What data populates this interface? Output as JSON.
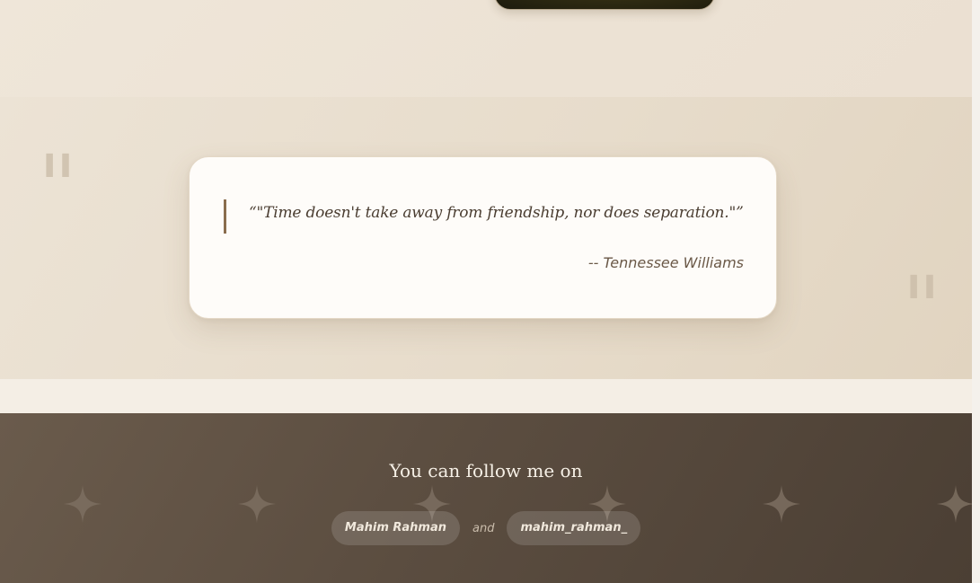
{
  "quote": {
    "text": "“\"Time doesn't take away from friendship, nor does separation.\"”",
    "author": "-- Tennessee Williams",
    "decor_left": "\"",
    "decor_right": "\""
  },
  "footer": {
    "title": "You can follow me on",
    "link_primary": "Mahim Rahman",
    "separator": "and",
    "link_secondary": "mahim_rahman_"
  },
  "icons": {
    "quote_decor": "quote-mark-icon",
    "footer_decor": "sparkle-icon"
  },
  "colors": {
    "card_background": "#fefcf9",
    "quote_accent": "#8a6d4e",
    "footer_background": "#5b4d40",
    "footer_text": "#f6f0e6"
  }
}
